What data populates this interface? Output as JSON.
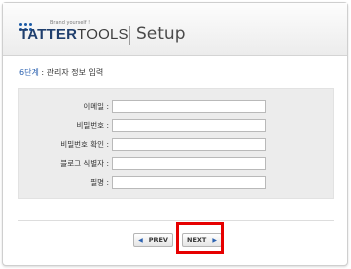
{
  "header": {
    "tagline": "Brand yourself !",
    "brand_part1": "TATTER",
    "brand_part2": "TOOLS",
    "title": "Setup",
    "brand_color": "#1a5aa6"
  },
  "step": {
    "number": "6단계",
    "separator": " : ",
    "title": "관리자 정보 입력",
    "accent_color": "#2c62b0"
  },
  "form": {
    "fields": [
      {
        "label": "이메일 :",
        "value": ""
      },
      {
        "label": "비밀번호 :",
        "value": ""
      },
      {
        "label": "비밀번호 확인 :",
        "value": ""
      },
      {
        "label": "블로그 식별자 :",
        "value": ""
      },
      {
        "label": "필명 :",
        "value": ""
      }
    ]
  },
  "nav": {
    "prev_label": "PREV",
    "next_label": "NEXT",
    "prev_icon": "triangle-left-icon",
    "next_icon": "triangle-right-icon",
    "highlight_color": "#e60000"
  }
}
